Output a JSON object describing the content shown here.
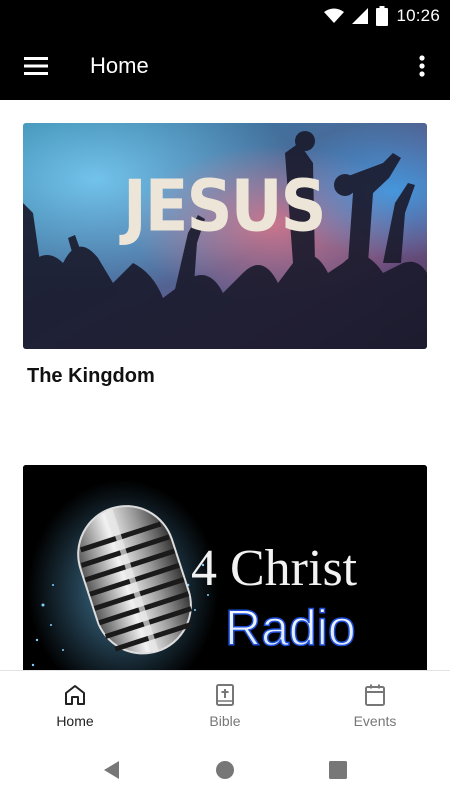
{
  "status_bar": {
    "time": "10:26"
  },
  "app_bar": {
    "title": "Home"
  },
  "cards": [
    {
      "title": "The Kingdom",
      "image_text": "JESUS"
    },
    {
      "title": "",
      "image_text_line1": "4 Christ",
      "image_text_line2": "Radio"
    }
  ],
  "bottom_nav": {
    "items": [
      {
        "label": "Home",
        "icon": "home-icon",
        "active": true
      },
      {
        "label": "Bible",
        "icon": "bible-icon",
        "active": false
      },
      {
        "label": "Events",
        "icon": "calendar-icon",
        "active": false
      }
    ]
  },
  "colors": {
    "app_bar": "#000000",
    "radio_text": "#ffffff",
    "radio_glow": "#1e4ed8"
  }
}
